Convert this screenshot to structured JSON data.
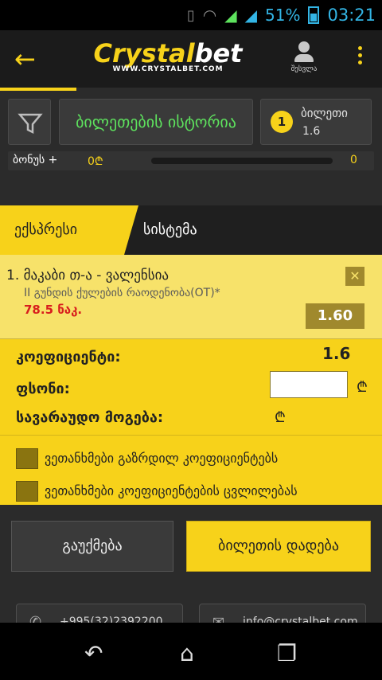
{
  "statusbar": {
    "battery": "51%",
    "time": "03:21"
  },
  "header": {
    "logo_text_a": "Crystal",
    "logo_text_b": "bet",
    "logo_url": "WWW.CRYSTALBET.COM",
    "login_label": "შესვლა"
  },
  "panel": {
    "history_label": "ბილეთების ისტორია",
    "ticket_count": "1",
    "ticket_label": "ბილეთი",
    "ticket_odds": "1.6",
    "bonus_label": "ბონუს +",
    "bonus_amount": "0₾",
    "bonus_right": "0",
    "bonus_progress": 0
  },
  "tabs": {
    "express": "ექსპრესი",
    "system": "სისტემა"
  },
  "bet": {
    "title": "1.  მაკაბი თ-ა - ვალენსია",
    "market": "II გუნდის ქულების რაოდენობა(OT)*",
    "line": "78.5 ნაკ.",
    "odds": "1.60",
    "close_icon": "✕"
  },
  "calc": {
    "coef_label": "კოეფიციენტი:",
    "coef_value": "1.6",
    "stake_label": "ფსონი:",
    "stake_value": "",
    "currency": "₾",
    "payout_label": "სავარაუდო მოგება:"
  },
  "options": {
    "accept_increased": "ვეთანხმები გაზრდილ კოეფიციენტებს",
    "accept_changes": "ვეთანხმები კოეფიციენტების ცვლილებას"
  },
  "actions": {
    "clear": "გაუქმება",
    "place": "ბილეთის დადება"
  },
  "contacts": {
    "phone": "+995(32)2392200",
    "email": "info@crystalbet.com"
  },
  "colors": {
    "accent": "#f7d21a",
    "dark": "#2b2b2b",
    "green": "#5ee35e",
    "red": "#d81e1e"
  }
}
